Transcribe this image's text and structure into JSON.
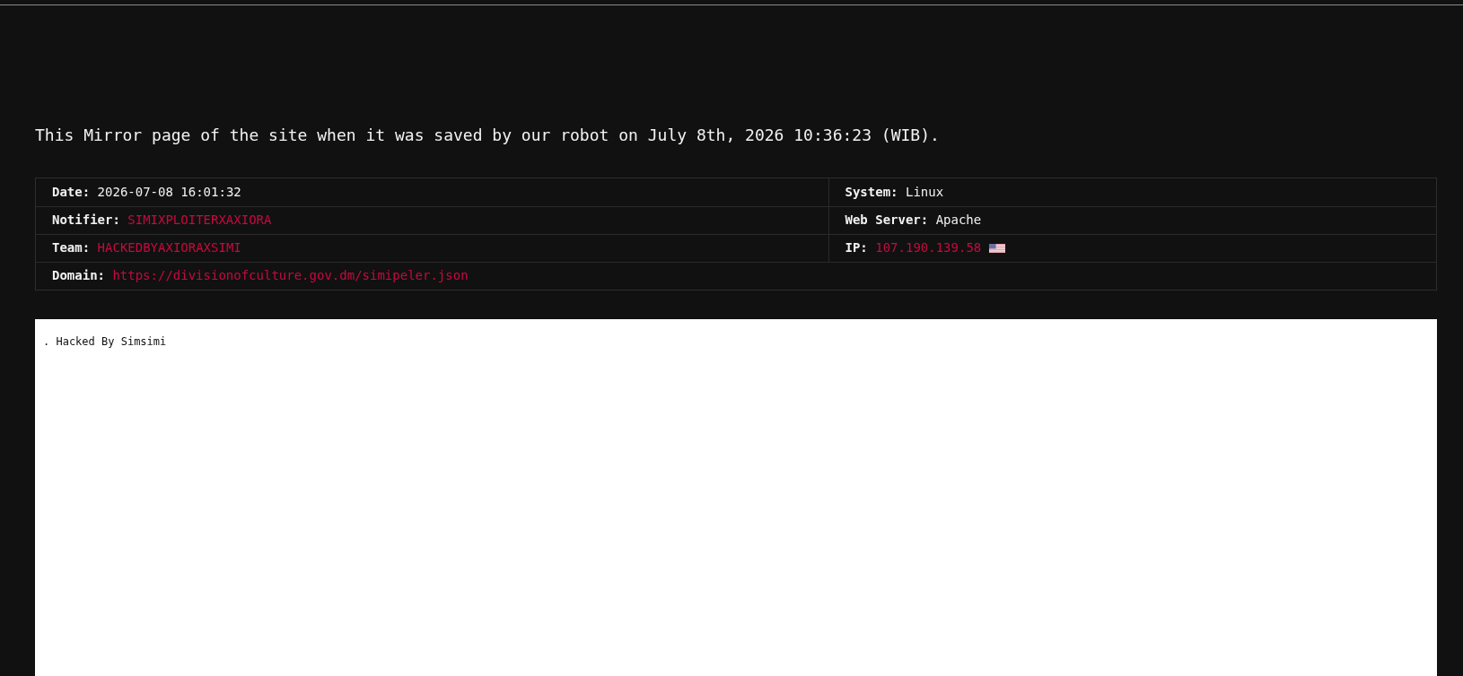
{
  "notice": "This Mirror page of the site when it was saved by our robot on July 8th, 2026 10:36:23 (WIB).",
  "details": {
    "rows": [
      {
        "cells": [
          {
            "label": "Date:",
            "value": "2026-07-08 16:01:32",
            "kind": "text"
          },
          {
            "label": "System:",
            "value": "Linux",
            "kind": "text"
          }
        ]
      },
      {
        "cells": [
          {
            "label": "Notifier:",
            "value": "SIMIXPLOITERXAXIORA",
            "kind": "link"
          },
          {
            "label": "Web Server:",
            "value": "Apache",
            "kind": "text"
          }
        ]
      },
      {
        "cells": [
          {
            "label": "Team:",
            "value": "HACKEDBYAXIORAXSIMI",
            "kind": "link"
          },
          {
            "label": "IP:",
            "value": "107.190.139.58",
            "kind": "ip"
          }
        ]
      }
    ],
    "domain": {
      "label": "Domain:",
      "value": "https://divisionofculture.gov.dm/simipeler.json",
      "kind": "link"
    }
  },
  "mirror": {
    "text": ". Hacked By Simsimi"
  }
}
